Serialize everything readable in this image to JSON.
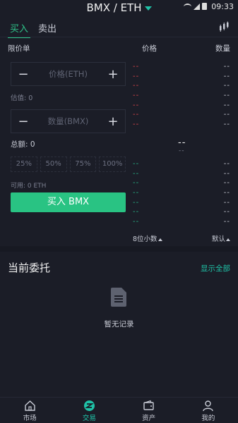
{
  "status": {
    "time": "09:33"
  },
  "header": {
    "pair": "BMX / ETH"
  },
  "tabs": [
    {
      "label": "买入"
    },
    {
      "label": "卖出"
    }
  ],
  "form": {
    "order_type": "限价单",
    "price_placeholder": "价格(ETH)",
    "qty_placeholder": "数量(BMX)",
    "estimate": "估值: 0",
    "total": "总额: 0",
    "percents": [
      "25%",
      "50%",
      "75%",
      "100%"
    ],
    "available": "可用: 0 ETH",
    "buy_button": "买入 BMX",
    "minus": "−",
    "plus": "+"
  },
  "orderbook": {
    "price_header": "价格",
    "qty_header": "数量",
    "placeholder": "--",
    "mid_price": "--",
    "mid_sub": "--",
    "precision": "8位小数",
    "default": "默认",
    "colors": {
      "ask": "#e0454b",
      "bid": "#27b88a"
    }
  },
  "orders": {
    "title": "当前委托",
    "show_all": "显示全部",
    "empty": "暂无记录"
  },
  "nav": [
    {
      "label": "市场",
      "icon": "home-icon"
    },
    {
      "label": "交易",
      "icon": "trade-icon"
    },
    {
      "label": "资产",
      "icon": "wallet-icon"
    },
    {
      "label": "我的",
      "icon": "user-icon"
    }
  ],
  "accent": "#1fc2a7",
  "buy_color": "#29c383"
}
